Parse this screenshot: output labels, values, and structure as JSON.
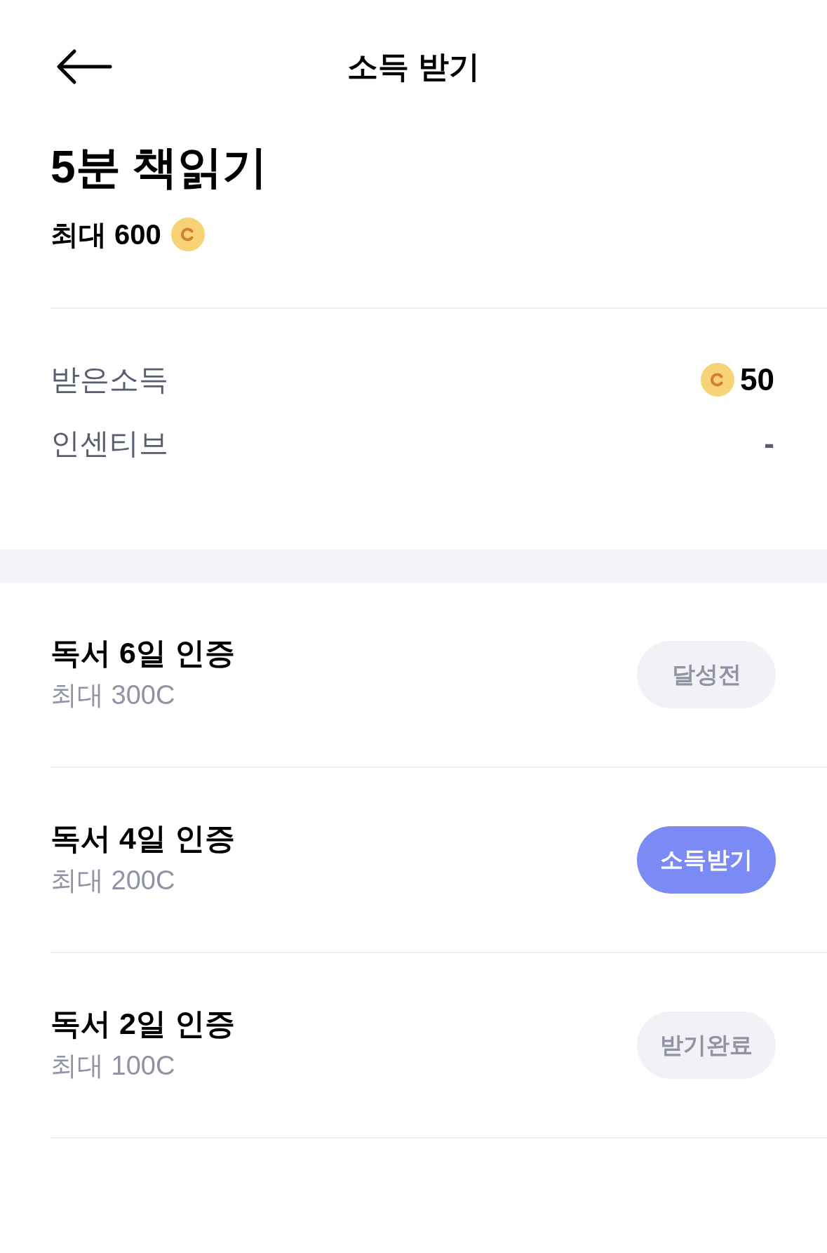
{
  "header": {
    "title": "소득 받기"
  },
  "summary": {
    "title": "5분 책읽기",
    "max_text": "최대 600"
  },
  "earnings": [
    {
      "label": "받은소득",
      "value": "50",
      "coin": true
    },
    {
      "label": "인센티브",
      "value": "-",
      "coin": false
    }
  ],
  "missions": [
    {
      "title": "독서 6일 인증",
      "subtitle": "최대 300C",
      "button": {
        "label": "달성전",
        "disabled": true
      }
    },
    {
      "title": "독서 4일 인증",
      "subtitle": "최대 200C",
      "button": {
        "label": "소득받기",
        "disabled": false
      }
    },
    {
      "title": "독서 2일 인증",
      "subtitle": "최대 100C",
      "button": {
        "label": "받기완료",
        "disabled": true
      }
    }
  ]
}
